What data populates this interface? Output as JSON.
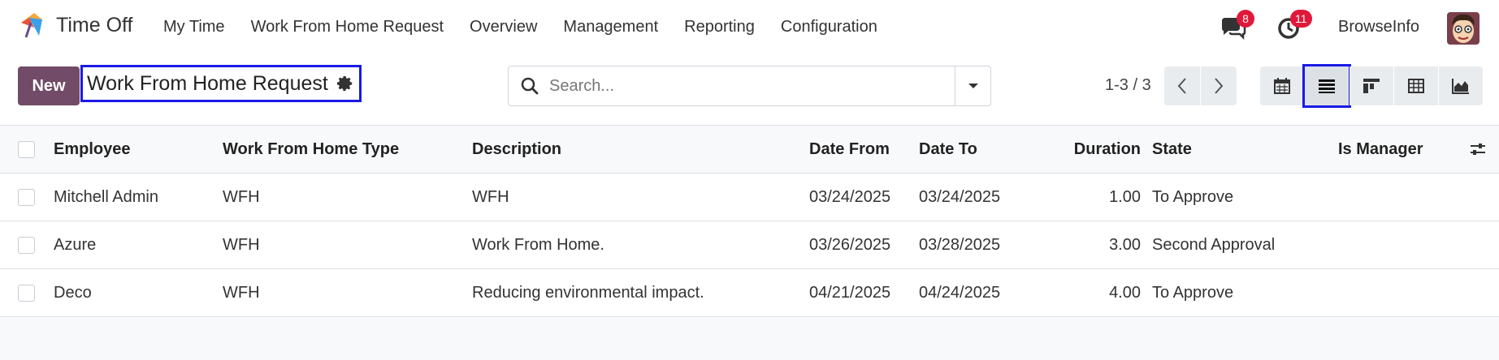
{
  "app": {
    "name": "Time Off"
  },
  "menu": [
    {
      "label": "My Time"
    },
    {
      "label": "Work From Home Request"
    },
    {
      "label": "Overview"
    },
    {
      "label": "Management"
    },
    {
      "label": "Reporting"
    },
    {
      "label": "Configuration"
    }
  ],
  "systray": {
    "messages_count": "8",
    "activities_count": "11",
    "company": "BrowseInfo"
  },
  "control_panel": {
    "new_label": "New",
    "breadcrumb": "Work From Home Request",
    "search_placeholder": "Search...",
    "pager": "1-3 / 3",
    "views": [
      "calendar",
      "list",
      "kanban",
      "pivot",
      "graph"
    ],
    "active_view": "list"
  },
  "table": {
    "columns": {
      "employee": "Employee",
      "type": "Work From Home Type",
      "description": "Description",
      "date_from": "Date From",
      "date_to": "Date To",
      "duration": "Duration",
      "state": "State",
      "is_manager": "Is Manager"
    },
    "rows": [
      {
        "employee": "Mitchell Admin",
        "type": "WFH",
        "description": "WFH",
        "date_from": "03/24/2025",
        "date_to": "03/24/2025",
        "duration": "1.00",
        "state": "To Approve",
        "is_manager": ""
      },
      {
        "employee": "Azure",
        "type": "WFH",
        "description": "Work From Home.",
        "date_from": "03/26/2025",
        "date_to": "03/28/2025",
        "duration": "3.00",
        "state": "Second Approval",
        "is_manager": ""
      },
      {
        "employee": "Deco",
        "type": "WFH",
        "description": "Reducing environmental impact.",
        "date_from": "04/21/2025",
        "date_to": "04/24/2025",
        "duration": "4.00",
        "state": "To Approve",
        "is_manager": ""
      }
    ]
  },
  "colors": {
    "brand": "#714b67",
    "badge": "#e0183a",
    "highlight": "#1a1ae6"
  }
}
